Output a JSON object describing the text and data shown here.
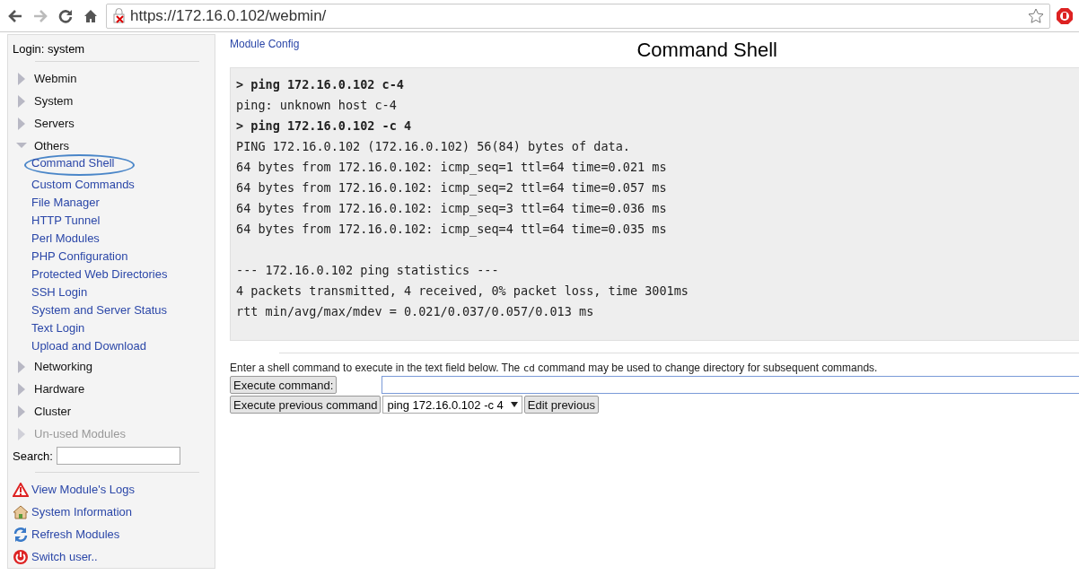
{
  "browser": {
    "url": "https://172.16.0.102/webmin/"
  },
  "sidebar": {
    "login": "Login: system",
    "categories": [
      {
        "label": "Webmin",
        "expanded": false,
        "disabled": false
      },
      {
        "label": "System",
        "expanded": false,
        "disabled": false
      },
      {
        "label": "Servers",
        "expanded": false,
        "disabled": false
      },
      {
        "label": "Others",
        "expanded": true,
        "disabled": false,
        "children": [
          {
            "label": "Command Shell",
            "selected": true
          },
          {
            "label": "Custom Commands",
            "selected": false
          },
          {
            "label": "File Manager",
            "selected": false
          },
          {
            "label": "HTTP Tunnel",
            "selected": false
          },
          {
            "label": "Perl Modules",
            "selected": false
          },
          {
            "label": "PHP Configuration",
            "selected": false
          },
          {
            "label": "Protected Web Directories",
            "selected": false
          },
          {
            "label": "SSH Login",
            "selected": false
          },
          {
            "label": "System and Server Status",
            "selected": false
          },
          {
            "label": "Text Login",
            "selected": false
          },
          {
            "label": "Upload and Download",
            "selected": false
          }
        ]
      },
      {
        "label": "Networking",
        "expanded": false,
        "disabled": false
      },
      {
        "label": "Hardware",
        "expanded": false,
        "disabled": false
      },
      {
        "label": "Cluster",
        "expanded": false,
        "disabled": false
      },
      {
        "label": "Un-used Modules",
        "expanded": false,
        "disabled": true
      }
    ],
    "search_label": "Search:",
    "links": [
      {
        "kind": "warning",
        "label": "View Module's Logs"
      },
      {
        "kind": "home",
        "label": "System Information"
      },
      {
        "kind": "refresh",
        "label": "Refresh Modules"
      },
      {
        "kind": "power",
        "label": "Switch user.."
      }
    ]
  },
  "main": {
    "module_config": "Module Config",
    "title": "Command Shell",
    "output": [
      {
        "kind": "command",
        "text": "> ping 172.16.0.102 c-4"
      },
      {
        "kind": "output",
        "text": "ping: unknown host c-4"
      },
      {
        "kind": "command",
        "text": "> ping 172.16.0.102 -c 4"
      },
      {
        "kind": "output",
        "text": "PING 172.16.0.102 (172.16.0.102) 56(84) bytes of data."
      },
      {
        "kind": "output",
        "text": "64 bytes from 172.16.0.102: icmp_seq=1 ttl=64 time=0.021 ms"
      },
      {
        "kind": "output",
        "text": "64 bytes from 172.16.0.102: icmp_seq=2 ttl=64 time=0.057 ms"
      },
      {
        "kind": "output",
        "text": "64 bytes from 172.16.0.102: icmp_seq=3 ttl=64 time=0.036 ms"
      },
      {
        "kind": "output",
        "text": "64 bytes from 172.16.0.102: icmp_seq=4 ttl=64 time=0.035 ms"
      },
      {
        "kind": "blank"
      },
      {
        "kind": "output",
        "text": "--- 172.16.0.102 ping statistics ---"
      },
      {
        "kind": "output",
        "text": "4 packets transmitted, 4 received, 0% packet loss, time 3001ms"
      },
      {
        "kind": "output",
        "text": "rtt min/avg/max/mdev = 0.021/0.037/0.057/0.013 ms"
      }
    ],
    "help": {
      "before": "Enter a shell command to execute in the text field below. The",
      "code": "cd",
      "after": "command may be used to change directory for subsequent commands."
    },
    "execute_button": "Execute command:",
    "execute_previous_button": "Execute previous command",
    "previous_select": "ping 172.16.0.102 -c 4",
    "edit_previous_button": "Edit previous"
  }
}
